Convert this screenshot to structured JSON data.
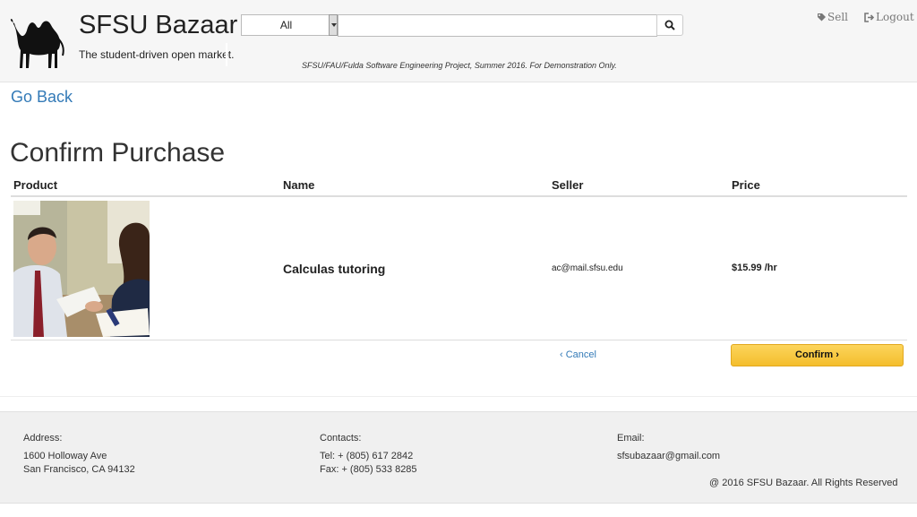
{
  "header": {
    "brand_title": "SFSU Bazaar",
    "tagline": "The student-driven open market.",
    "category_value": "All",
    "search_value": "",
    "search_placeholder": "",
    "project_note": "SFSU/FAU/Fulda Software Engineering Project, Summer 2016. For Demonstration Only.",
    "sell_label": "Sell",
    "logout_label": "Logout",
    "icons": {
      "logo": "camel-logo",
      "search": "search-icon",
      "sell": "tag-icon",
      "logout": "sign-out-icon"
    }
  },
  "main": {
    "go_back": "Go Back",
    "title": "Confirm Purchase",
    "columns": [
      "Product",
      "Name",
      "Seller",
      "Price"
    ],
    "item": {
      "name": "Calculas tutoring",
      "seller": "ac@mail.sfsu.edu",
      "price": "$15.99 /hr"
    },
    "cancel_label": "Cancel",
    "confirm_label": "Confirm"
  },
  "footer": {
    "address_label": "Address:",
    "address_line1": "1600 Holloway Ave",
    "address_line2": "San Francisco, CA 94132",
    "contacts_label": "Contacts:",
    "tel": "Tel: + (805) 617 2842",
    "fax": "Fax: + (805) 533 8285",
    "email_label": "Email:",
    "email": "sfsubazaar@gmail.com",
    "copyright": "@ 2016 SFSU Bazaar. All Rights Reserved"
  },
  "colors": {
    "link": "#337ab7",
    "confirm": "#f4be2c",
    "header_bg": "#f6f6f6"
  }
}
